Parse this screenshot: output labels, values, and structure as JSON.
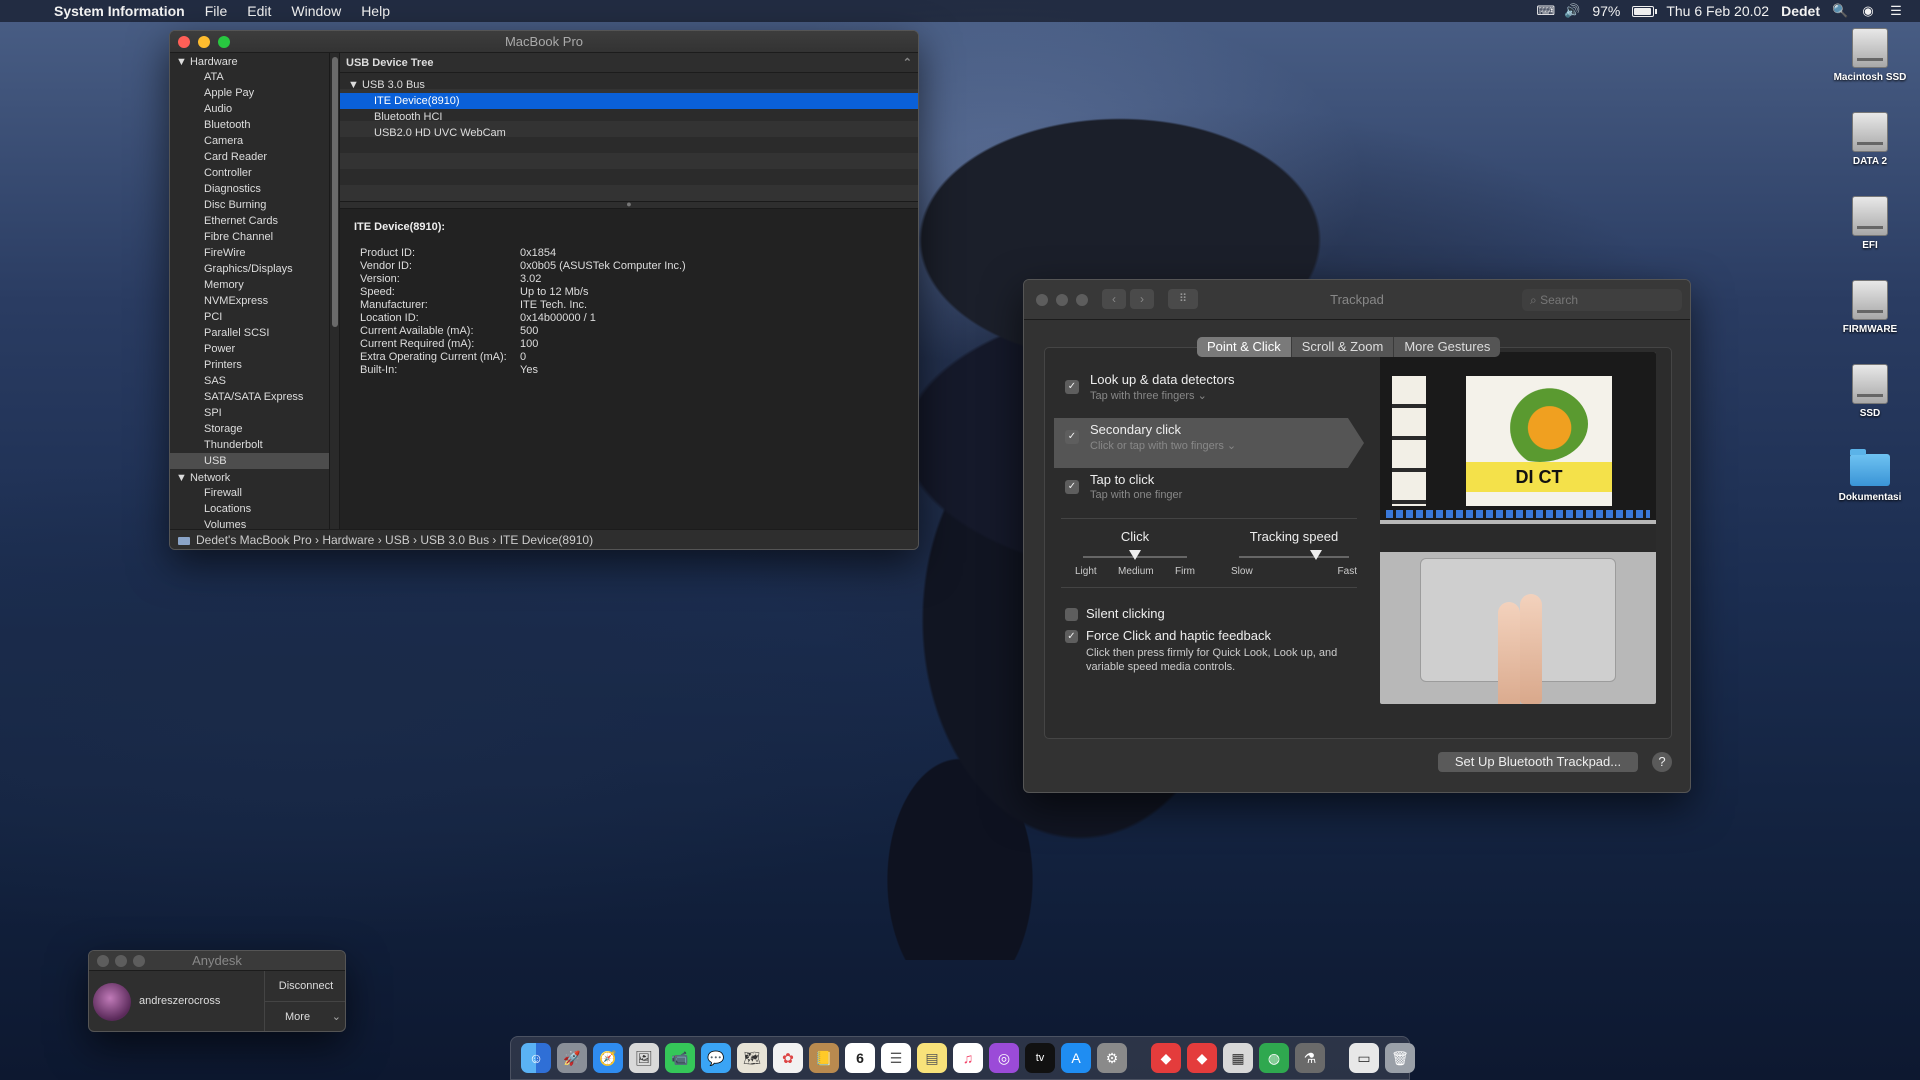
{
  "menubar": {
    "app": "System Information",
    "menus": [
      "File",
      "Edit",
      "Window",
      "Help"
    ],
    "battery": "97%",
    "datetime": "Thu 6 Feb  20.02",
    "user": "Dedet"
  },
  "sysinfo": {
    "title": "MacBook Pro",
    "sidebar": {
      "hardware_label": "Hardware",
      "hardware_items": [
        "ATA",
        "Apple Pay",
        "Audio",
        "Bluetooth",
        "Camera",
        "Card Reader",
        "Controller",
        "Diagnostics",
        "Disc Burning",
        "Ethernet Cards",
        "Fibre Channel",
        "FireWire",
        "Graphics/Displays",
        "Memory",
        "NVMExpress",
        "PCI",
        "Parallel SCSI",
        "Power",
        "Printers",
        "SAS",
        "SATA/SATA Express",
        "SPI",
        "Storage",
        "Thunderbolt",
        "USB"
      ],
      "network_label": "Network",
      "network_items": [
        "Firewall",
        "Locations",
        "Volumes"
      ]
    },
    "tree_header": "USB Device Tree",
    "tree": {
      "bus": "USB 3.0 Bus",
      "devices": [
        "ITE Device(8910)",
        "Bluetooth HCI",
        "USB2.0 HD UVC WebCam"
      ]
    },
    "detail": {
      "heading": "ITE Device(8910):",
      "rows": [
        {
          "k": "Product ID:",
          "v": "0x1854"
        },
        {
          "k": "Vendor ID:",
          "v": "0x0b05  (ASUSTek Computer Inc.)"
        },
        {
          "k": "Version:",
          "v": "3.02"
        },
        {
          "k": "Speed:",
          "v": "Up to 12 Mb/s"
        },
        {
          "k": "Manufacturer:",
          "v": "ITE Tech. Inc."
        },
        {
          "k": "Location ID:",
          "v": "0x14b00000 / 1"
        },
        {
          "k": "Current Available (mA):",
          "v": "500"
        },
        {
          "k": "Current Required (mA):",
          "v": "100"
        },
        {
          "k": "Extra Operating Current (mA):",
          "v": "0"
        },
        {
          "k": "Built-In:",
          "v": "Yes"
        }
      ]
    },
    "path": "Dedet's MacBook Pro  ›  Hardware  ›  USB  ›  USB 3.0 Bus  ›  ITE Device(8910)"
  },
  "trackpad": {
    "title": "Trackpad",
    "search_placeholder": "Search",
    "tabs": [
      "Point & Click",
      "Scroll & Zoom",
      "More Gestures"
    ],
    "options": [
      {
        "title": "Look up & data detectors",
        "sub": "Tap with three fingers ⌄"
      },
      {
        "title": "Secondary click",
        "sub": "Click or tap with two fingers ⌄"
      },
      {
        "title": "Tap to click",
        "sub": "Tap with one finger"
      }
    ],
    "click_slider": {
      "name": "Click",
      "labels": [
        "Light",
        "Medium",
        "Firm"
      ],
      "value": 0.5
    },
    "tracking_slider": {
      "name": "Tracking speed",
      "labels": [
        "Slow",
        "Fast"
      ],
      "value": 0.7
    },
    "silent_clicking": "Silent clicking",
    "force_click": "Force Click and haptic feedback",
    "force_click_desc": "Click then press firmly for Quick Look, Look up, and variable speed media controls.",
    "preview_text": "DI    CT",
    "setup_button": "Set Up Bluetooth Trackpad...",
    "help": "?"
  },
  "anydesk": {
    "title": "Anydesk",
    "user": "andreszerocross",
    "disconnect": "Disconnect",
    "more": "More"
  },
  "desktop_icons": [
    "Macintosh SSD",
    "DATA 2",
    "EFI",
    "FIRMWARE",
    "SSD",
    "Dokumentasi"
  ],
  "dock": {
    "calendar_day": "6",
    "tv_label": "tv"
  }
}
